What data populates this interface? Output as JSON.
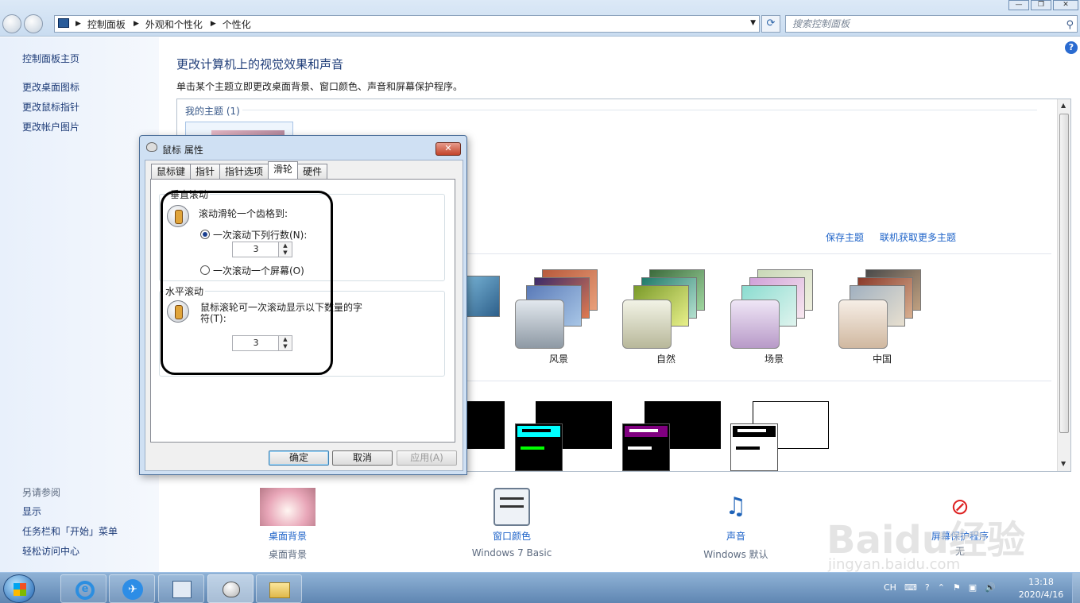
{
  "window": {
    "breadcrumb": [
      "控制面板",
      "外观和个性化",
      "个性化"
    ],
    "search_placeholder": "搜索控制面板"
  },
  "leftnav": {
    "links": [
      "控制面板主页",
      "更改桌面图标",
      "更改鼠标指针",
      "更改帐户图片"
    ],
    "seealso_title": "另请参阅",
    "seealso_links": [
      "显示",
      "任务栏和「开始」菜单",
      "轻松访问中心"
    ]
  },
  "main": {
    "title": "更改计算机上的视觉效果和声音",
    "subtitle": "单击某个主题立即更改桌面背景、窗口颜色、声音和屏幕保护程序。",
    "my_themes": "我的主题 (1)",
    "save_theme": "保存主题",
    "get_more": "联机获取更多主题",
    "themes": [
      "风景",
      "自然",
      "场景",
      "中国"
    ]
  },
  "bottom": [
    {
      "label": "桌面背景",
      "sub": "桌面背景"
    },
    {
      "label": "窗口颜色",
      "sub": "Windows 7 Basic"
    },
    {
      "label": "声音",
      "sub": "Windows 默认"
    },
    {
      "label": "屏幕保护程序",
      "sub": "无"
    }
  ],
  "dialog": {
    "title": "鼠标 属性",
    "tabs": [
      "鼠标键",
      "指针",
      "指针选项",
      "滑轮",
      "硬件"
    ],
    "active_tab": "滑轮",
    "vertical_group": "垂直滚动",
    "vertical_text": "滚动滑轮一个齿格到:",
    "radio_lines": "一次滚动下列行数(N):",
    "radio_screen": "一次滚动一个屏幕(O)",
    "lines_value": "3",
    "horizontal_group": "水平滚动",
    "horizontal_text_1": "鼠标滚轮可一次滚动显示以下数量的字",
    "horizontal_text_2": "符(T):",
    "chars_value": "3",
    "ok": "确定",
    "cancel": "取消",
    "apply": "应用(A)"
  },
  "taskbar": {
    "lang": "CH",
    "time": "13:18",
    "date": "2020/4/16"
  },
  "watermark": {
    "text": "Baidu经验",
    "sub": "jingyan.baidu.com"
  }
}
